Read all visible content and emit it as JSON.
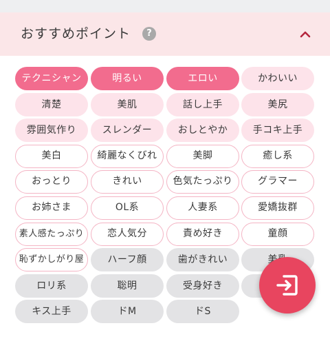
{
  "header": {
    "title": "おすすめポイント",
    "help_symbol": "?"
  },
  "tags": [
    {
      "label": "テクニシャン",
      "state": "active"
    },
    {
      "label": "明るい",
      "state": "active"
    },
    {
      "label": "エロい",
      "state": "active"
    },
    {
      "label": "かわいい",
      "state": "light"
    },
    {
      "label": "清楚",
      "state": "light"
    },
    {
      "label": "美肌",
      "state": "light"
    },
    {
      "label": "話し上手",
      "state": "light"
    },
    {
      "label": "美尻",
      "state": "light"
    },
    {
      "label": "雰囲気作り",
      "state": "light"
    },
    {
      "label": "スレンダー",
      "state": "light"
    },
    {
      "label": "おしとやか",
      "state": "light"
    },
    {
      "label": "手コキ上手",
      "state": "light"
    },
    {
      "label": "美白",
      "state": "outline"
    },
    {
      "label": "綺麗なくびれ",
      "state": "outline"
    },
    {
      "label": "美脚",
      "state": "outline"
    },
    {
      "label": "癒し系",
      "state": "outline"
    },
    {
      "label": "おっとり",
      "state": "outline"
    },
    {
      "label": "きれい",
      "state": "outline"
    },
    {
      "label": "色気たっぷり",
      "state": "outline"
    },
    {
      "label": "グラマー",
      "state": "outline"
    },
    {
      "label": "お姉さま",
      "state": "outline"
    },
    {
      "label": "OL系",
      "state": "outline"
    },
    {
      "label": "人妻系",
      "state": "outline"
    },
    {
      "label": "愛嬌抜群",
      "state": "outline"
    },
    {
      "label": "素人感たっぷり",
      "state": "outline"
    },
    {
      "label": "恋人気分",
      "state": "outline"
    },
    {
      "label": "責め好き",
      "state": "outline"
    },
    {
      "label": "童顔",
      "state": "outline"
    },
    {
      "label": "恥ずかしがり屋",
      "state": "outline"
    },
    {
      "label": "ハーフ顔",
      "state": "gray"
    },
    {
      "label": "歯がきれい",
      "state": "gray"
    },
    {
      "label": "美乳",
      "state": "gray"
    },
    {
      "label": "ロリ系",
      "state": "gray"
    },
    {
      "label": "聡明",
      "state": "gray"
    },
    {
      "label": "受身好き",
      "state": "gray"
    },
    {
      "label": "",
      "state": "gray"
    },
    {
      "label": "キス上手",
      "state": "gray"
    },
    {
      "label": "ドM",
      "state": "gray"
    },
    {
      "label": "ドS",
      "state": "gray"
    }
  ],
  "icons": {
    "help": "question-circle-icon",
    "collapse": "chevron-up-icon",
    "fab": "enter-icon"
  },
  "colors": {
    "header_bg": "#fbe6e8",
    "active_pill": "#f26c8e",
    "light_pill": "#fde3ea",
    "outline_border": "#f4b4c4",
    "gray_pill": "#e3e3e5",
    "fab": "#e8455f",
    "chevron": "#b5253d"
  }
}
